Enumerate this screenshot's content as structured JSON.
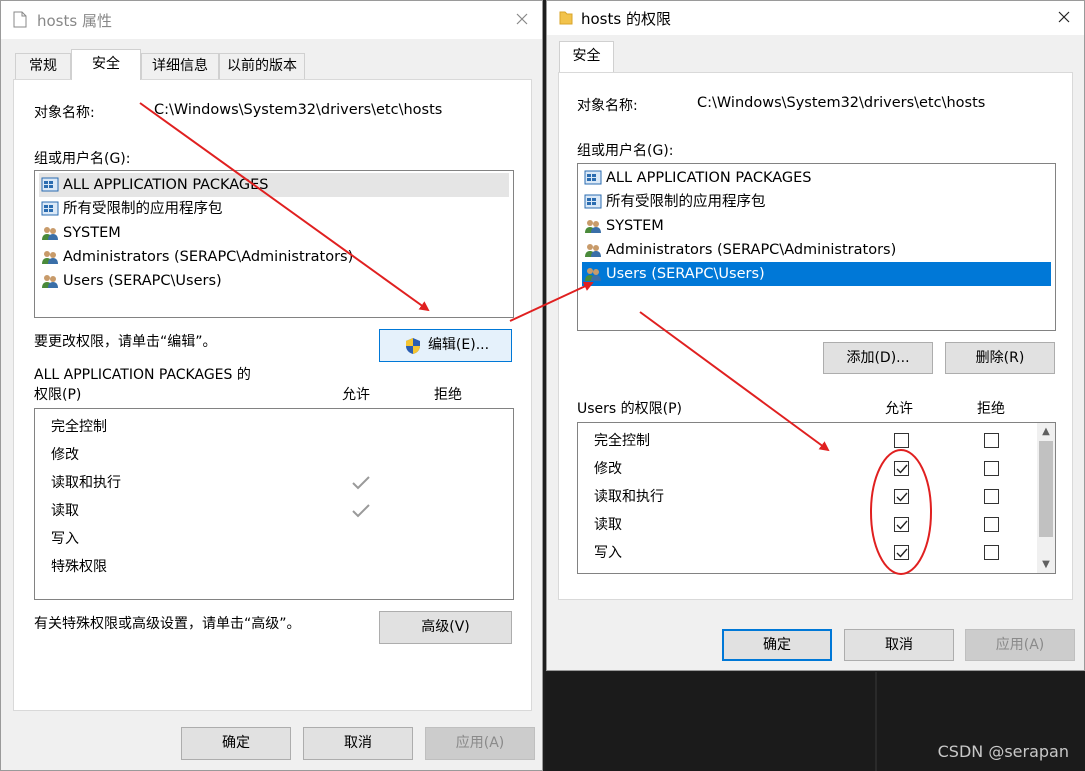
{
  "dialog1": {
    "title": "hosts 属性",
    "tabs": [
      "常规",
      "安全",
      "详细信息",
      "以前的版本"
    ],
    "object_name_label": "对象名称:",
    "object_name_value": "C:\\Windows\\System32\\drivers\\etc\\hosts",
    "group_label": "组或用户名(G):",
    "users": [
      {
        "label": "ALL APPLICATION PACKAGES",
        "icon": "app-package-icon"
      },
      {
        "label": "所有受限制的应用程序包",
        "icon": "app-package-icon"
      },
      {
        "label": "SYSTEM",
        "icon": "users-icon"
      },
      {
        "label": "Administrators (SERAPC\\Administrators)",
        "icon": "users-icon"
      },
      {
        "label": "Users (SERAPC\\Users)",
        "icon": "users-icon"
      }
    ],
    "edit_hint": "要更改权限，请单击“编辑”。",
    "edit_button": "编辑(E)...",
    "perm_header_line1": "ALL APPLICATION PACKAGES 的",
    "perm_header_line2": "权限(P)",
    "allow_label": "允许",
    "deny_label": "拒绝",
    "permissions": [
      {
        "name": "完全控制",
        "allow": false
      },
      {
        "name": "修改",
        "allow": false
      },
      {
        "name": "读取和执行",
        "allow": true
      },
      {
        "name": "读取",
        "allow": true
      },
      {
        "name": "写入",
        "allow": false
      },
      {
        "name": "特殊权限",
        "allow": false
      }
    ],
    "advanced_hint": "有关特殊权限或高级设置，请单击“高级”。",
    "advanced_button": "高级(V)",
    "ok_button": "确定",
    "cancel_button": "取消",
    "apply_button": "应用(A)"
  },
  "dialog2": {
    "title": "hosts 的权限",
    "tab": "安全",
    "object_name_label": "对象名称:",
    "object_name_value": "C:\\Windows\\System32\\drivers\\etc\\hosts",
    "group_label": "组或用户名(G):",
    "users": [
      {
        "label": "ALL APPLICATION PACKAGES",
        "icon": "app-package-icon"
      },
      {
        "label": "所有受限制的应用程序包",
        "icon": "app-package-icon"
      },
      {
        "label": "SYSTEM",
        "icon": "users-icon"
      },
      {
        "label": "Administrators (SERAPC\\Administrators)",
        "icon": "users-icon"
      },
      {
        "label": "Users (SERAPC\\Users)",
        "icon": "users-icon",
        "selected": true
      }
    ],
    "add_button": "添加(D)...",
    "remove_button": "删除(R)",
    "perm_header": "Users 的权限(P)",
    "allow_label": "允许",
    "deny_label": "拒绝",
    "permissions": [
      {
        "name": "完全控制",
        "allow": false,
        "deny": false
      },
      {
        "name": "修改",
        "allow": true,
        "deny": false
      },
      {
        "name": "读取和执行",
        "allow": true,
        "deny": false
      },
      {
        "name": "读取",
        "allow": true,
        "deny": false
      },
      {
        "name": "写入",
        "allow": true,
        "deny": false
      }
    ],
    "ok_button": "确定",
    "cancel_button": "取消",
    "apply_button": "应用(A)"
  },
  "watermark": "CSDN @serapan",
  "colors": {
    "selection": "#0078d7",
    "annotation_red": "#e02020",
    "dialog_bg": "#f0f0f0"
  }
}
